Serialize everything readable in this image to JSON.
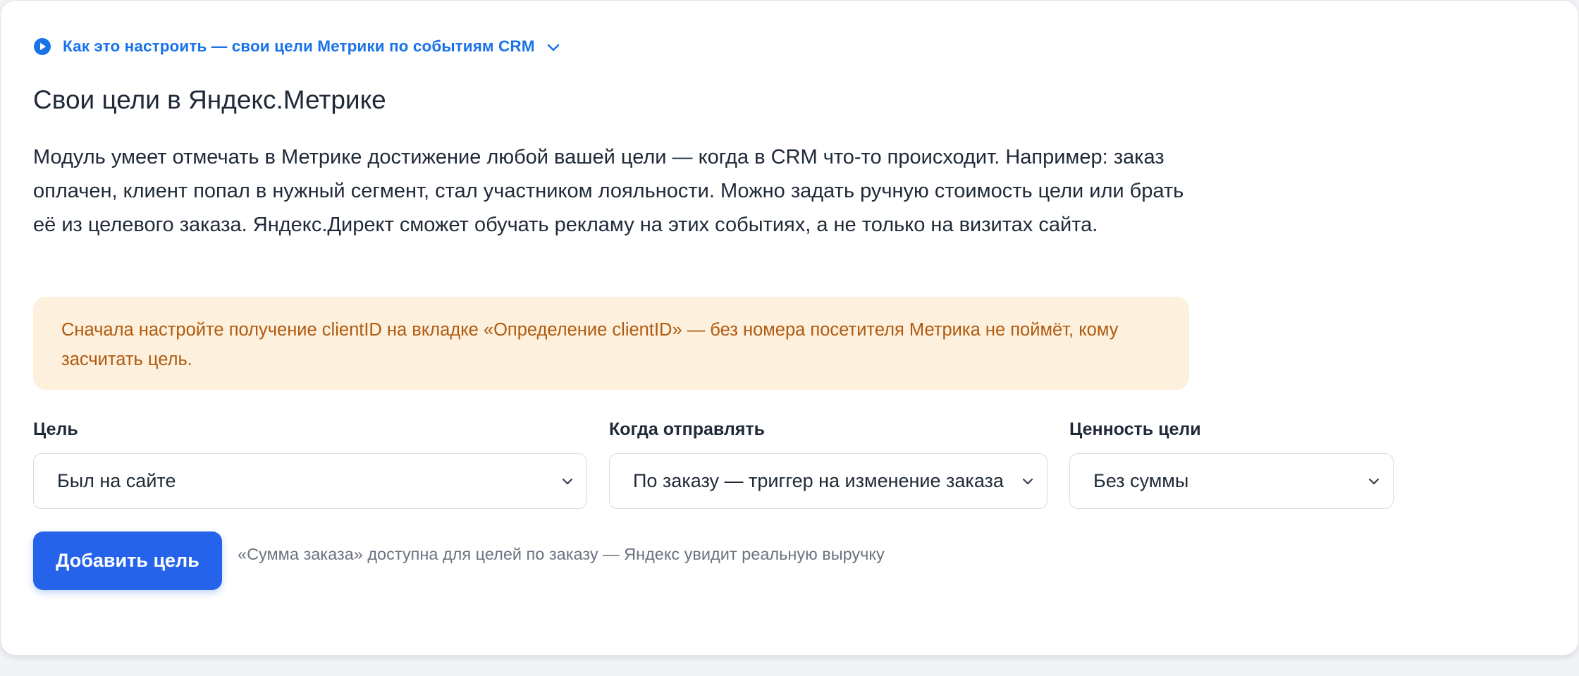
{
  "howto": {
    "label": "Как это настроить — свои цели Метрики по событиям CRM",
    "icon": "play-circle-icon",
    "toggle_icon": "chevron-down-icon",
    "color": "#1a73e8"
  },
  "section": {
    "title": "Свои цели в Яндекс.Метрике",
    "description": "Модуль умеет отмечать в Метрике достижение любой вашей цели — когда в CRM что-то происходит. Например: заказ оплачен, клиент попал в нужный сегмент, стал участником лояльности. Можно задать ручную стоимость цели или брать её из целевого заказа. Яндекс.Директ сможет обучать рекламу на этих событиях, а не только на визитах сайта."
  },
  "notice": {
    "text": "Сначала настройте получение clientID на вкладке «Определение clientID» — без номера посетителя Метрика не поймёт, кому засчитать цель.",
    "background": "#fdf0dc",
    "text_color": "#b05a10"
  },
  "form": {
    "goal": {
      "label": "Цель",
      "value": "Был на сайте"
    },
    "when": {
      "label": "Когда отправлять",
      "value": "По заказу — триггер на изменение заказа"
    },
    "value": {
      "label": "Ценность цели",
      "value": "Без суммы"
    },
    "add_button": "Добавить цель",
    "hint": "«Сумма заказа» доступна для целей по заказу — Яндекс увидит реальную выручку"
  },
  "colors": {
    "accent": "#2563eb",
    "text": "#1f2937",
    "muted": "#6b7280"
  }
}
